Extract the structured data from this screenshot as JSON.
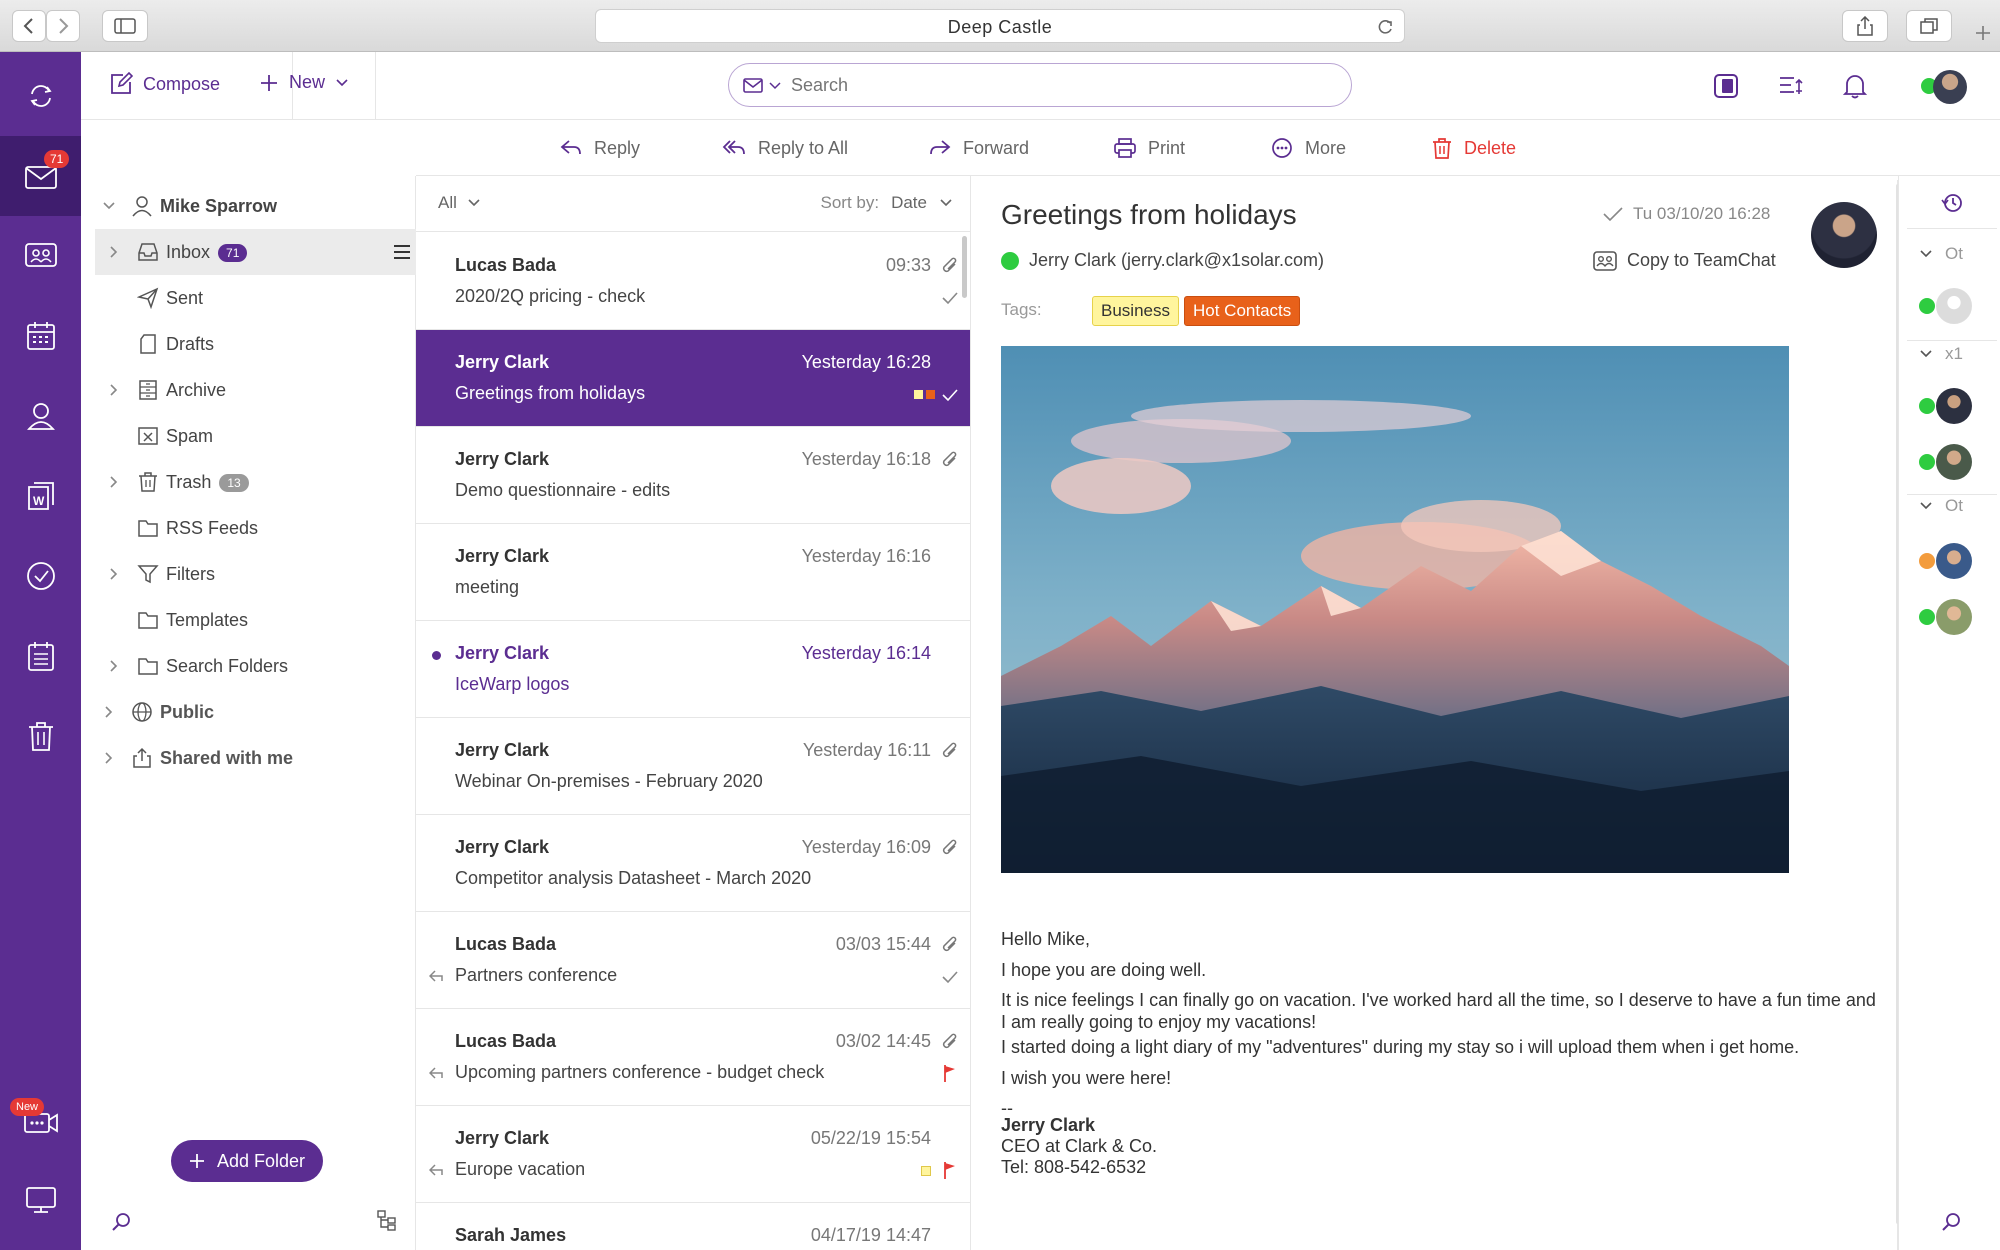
{
  "browser": {
    "url_title": "Deep Castle"
  },
  "rail": {
    "mail_badge": "71",
    "meeting_badge": "New"
  },
  "topbar": {
    "compose_label": "Compose",
    "new_label": "New",
    "search_placeholder": "Search"
  },
  "actions": {
    "reply": "Reply",
    "reply_all": "Reply to All",
    "forward": "Forward",
    "print": "Print",
    "more": "More",
    "delete": "Delete"
  },
  "folders": {
    "account": "Mike Sparrow",
    "items": [
      {
        "label": "Inbox",
        "count": "71"
      },
      {
        "label": "Sent"
      },
      {
        "label": "Drafts"
      },
      {
        "label": "Archive"
      },
      {
        "label": "Spam"
      },
      {
        "label": "Trash",
        "count": "13"
      },
      {
        "label": "RSS Feeds"
      },
      {
        "label": "Filters"
      },
      {
        "label": "Templates"
      },
      {
        "label": "Search Folders"
      }
    ],
    "public": "Public",
    "shared": "Shared with me",
    "add_folder": "Add Folder"
  },
  "list": {
    "filter": "All",
    "sort_label": "Sort by:",
    "sort_value": "Date",
    "messages": [
      {
        "from": "Lucas Bada",
        "subject": "2020/2Q pricing - check",
        "date": "09:33"
      },
      {
        "from": "Jerry Clark",
        "subject": "Greetings from holidays",
        "date": "Yesterday 16:28"
      },
      {
        "from": "Jerry Clark",
        "subject": "Demo questionnaire - edits",
        "date": "Yesterday 16:18"
      },
      {
        "from": "Jerry Clark",
        "subject": "meeting",
        "date": "Yesterday 16:16"
      },
      {
        "from": "Jerry Clark",
        "subject": "IceWarp logos",
        "date": "Yesterday 16:14"
      },
      {
        "from": "Jerry Clark",
        "subject": "Webinar On-premises - February 2020",
        "date": "Yesterday 16:11"
      },
      {
        "from": "Jerry Clark",
        "subject": "Competitor analysis Datasheet - March 2020",
        "date": "Yesterday 16:09"
      },
      {
        "from": "Lucas Bada",
        "subject": "Partners conference",
        "date": "03/03 15:44"
      },
      {
        "from": "Lucas Bada",
        "subject": "Upcoming partners conference - budget check",
        "date": "03/02 14:45"
      },
      {
        "from": "Jerry Clark",
        "subject": "Europe vacation",
        "date": "05/22/19 15:54"
      },
      {
        "from": "Sarah James",
        "subject": "",
        "date": "04/17/19 14:47"
      }
    ]
  },
  "reader": {
    "subject": "Greetings from holidays",
    "date": "Tu 03/10/20 16:28",
    "sender": "Jerry Clark (jerry.clark@x1solar.com)",
    "copy_to_teamchat": "Copy to TeamChat",
    "tags_label": "Tags:",
    "tags": [
      {
        "label": "Business",
        "color": "#fff59d"
      },
      {
        "label": "Hot Contacts",
        "color": "#e8611a"
      }
    ],
    "body": {
      "greeting": "Hello Mike,",
      "line1": "I hope you are doing well.",
      "line2": "It is nice feelings I can finally go on vacation. I've worked hard all the time, so I deserve to have a fun time and I am really going to enjoy my vacations!",
      "line3": "I started doing a light diary of my \"adventures\" during my stay so i will upload them when i get home.",
      "line4": "I wish you were here!",
      "sig_sep": "--",
      "sig_name": "Jerry Clark",
      "sig_title": "CEO at Clark & Co.",
      "sig_tel": "Tel: 808-542-6532"
    }
  },
  "contacts": {
    "groups": [
      "Ot",
      "x1",
      "Ot"
    ]
  },
  "colors": {
    "brand": "#5b2d91",
    "rail_active": "#3f1d6e",
    "delete": "#e53935"
  }
}
